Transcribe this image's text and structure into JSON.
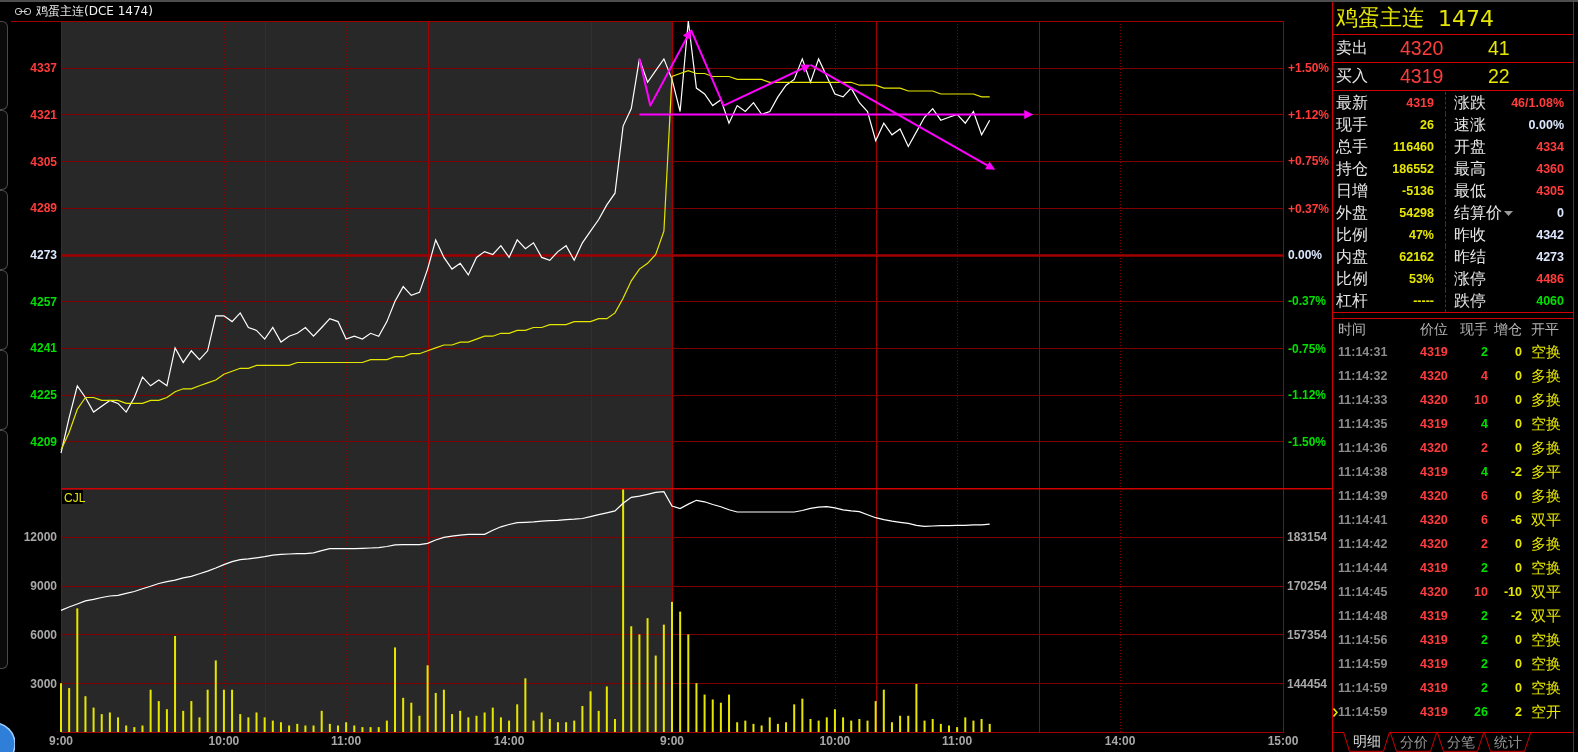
{
  "window": {
    "title": "鸡蛋主连(DCE 1474)"
  },
  "price_chart": {
    "chart_data": {
      "type": "line",
      "grid": true,
      "categories": [
        null,
        null,
        null,
        null,
        null,
        null,
        null,
        null,
        null,
        null,
        null,
        null,
        null,
        null,
        null,
        null,
        null,
        null,
        null,
        null,
        null,
        null,
        null,
        null,
        null,
        null,
        null,
        null,
        null,
        null,
        null,
        null,
        null,
        null,
        null,
        null,
        null,
        null,
        null,
        null,
        null,
        null,
        null,
        null,
        null,
        null,
        null,
        null,
        null,
        null,
        null,
        null,
        null,
        null,
        null,
        null,
        null,
        null,
        null,
        null,
        null,
        null,
        null,
        null,
        null,
        null,
        null,
        null,
        null,
        null,
        null,
        null,
        null,
        null,
        null,
        null,
        null,
        null,
        null,
        null,
        null,
        null,
        null,
        null,
        null,
        null,
        null,
        null,
        null,
        null,
        null,
        null,
        null,
        null,
        null,
        null,
        null,
        null,
        null,
        null,
        null,
        null,
        null,
        null,
        null,
        null,
        null,
        null,
        null,
        null,
        null,
        null,
        null,
        null,
        null,
        null,
        null,
        null,
        null,
        null,
        null,
        null,
        null,
        null,
        null,
        null,
        null,
        null,
        null,
        null,
        null,
        null,
        null,
        null,
        null,
        null,
        null,
        null,
        null,
        null,
        null,
        null,
        null,
        null,
        null,
        null,
        null,
        null,
        null,
        null,
        null
      ],
      "series": [
        {
          "color": "#ffffff",
          "values": [
            4205,
            4217,
            4228,
            4224,
            4219,
            4221,
            4223,
            4222,
            4219,
            4224,
            4231,
            4228,
            4230,
            4228,
            4241,
            4236,
            4240,
            4237,
            4240,
            4252,
            4252,
            4250,
            4253,
            4248,
            4247,
            4244,
            4248,
            4243,
            4245,
            4246,
            4248,
            4245,
            4248,
            4251,
            4250,
            4244,
            4245,
            4244,
            4246,
            4245,
            4250,
            4257,
            4262,
            4259,
            4260,
            4268,
            4278,
            4272,
            4268,
            4270,
            4266,
            4272,
            4274,
            4273,
            4276,
            4272,
            4278,
            4275,
            4277,
            4272,
            4271,
            4274,
            4276,
            4271,
            4277,
            4281,
            4285,
            4290,
            4294,
            4317,
            4323,
            4340,
            4332,
            4336,
            4340,
            4333,
            4322,
            4353,
            4330,
            4328,
            4324,
            4326,
            4318,
            4324,
            4322,
            4325,
            4321,
            4322,
            4327,
            4331,
            4333,
            4340,
            4332,
            4340,
            4334,
            4328,
            4327,
            4330,
            4325,
            4322,
            4312,
            4318,
            4314,
            4316,
            4310,
            4315,
            4320,
            4323,
            4319,
            4320,
            4321,
            4318,
            4322,
            4314,
            4319,
            null,
            null,
            null,
            null,
            null,
            null,
            null,
            null,
            null,
            null,
            null,
            null,
            null,
            null,
            null,
            null,
            null,
            null,
            null,
            null,
            null,
            null,
            null,
            null,
            null,
            null,
            null,
            null,
            null,
            null,
            null,
            null,
            null,
            null,
            null,
            null
          ]
        },
        {
          "color": "#e6e600",
          "values": [
            4206,
            4212,
            4220,
            4224,
            4224,
            4223,
            4223,
            4223,
            4222,
            4222,
            4222,
            4223,
            4223,
            4224,
            4226,
            4227,
            4227,
            4228,
            4229,
            4230,
            4232,
            4233,
            4234,
            4234,
            4235,
            4235,
            4235,
            4235,
            4235,
            4236,
            4236,
            4236,
            4236,
            4236,
            4236,
            4236,
            4236,
            4236,
            4237,
            4237,
            4237,
            4238,
            4238,
            4239,
            4239,
            4240,
            4241,
            4242,
            4242,
            4243,
            4243,
            4244,
            4245,
            4245,
            4246,
            4246,
            4247,
            4247,
            4248,
            4248,
            4249,
            4249,
            4249,
            4250,
            4250,
            4250,
            4251,
            4251,
            4253,
            4258,
            4264,
            4268,
            4270,
            4273,
            4281,
            4334,
            4335,
            4336,
            4335,
            4335,
            4334,
            4334,
            4334,
            4333,
            4333,
            4333,
            4333,
            4332,
            4332,
            4332,
            4332,
            4332,
            4332,
            4332,
            4332,
            4332,
            4332,
            4332,
            4331,
            4331,
            4331,
            4330,
            4330,
            4330,
            4329,
            4329,
            4329,
            4329,
            4328,
            4328,
            4328,
            4328,
            4328,
            4327,
            4327,
            null,
            null,
            null,
            null,
            null,
            null,
            null,
            null,
            null,
            null,
            null,
            null,
            null,
            null,
            null,
            null,
            null,
            null,
            null,
            null,
            null,
            null,
            null,
            null,
            null,
            null,
            null,
            null,
            null,
            null,
            null,
            null,
            null,
            null,
            null,
            null
          ]
        }
      ],
      "ylim": [
        4193,
        4353
      ],
      "yticks": [
        4209,
        4225,
        4241,
        4257,
        4273,
        4289,
        4305,
        4321,
        4337
      ],
      "y2lim": [
        -1.872,
        1.872
      ],
      "y2ticks": [
        {
          "value": -1.5,
          "label": "-1.50%"
        },
        {
          "value": -1.12,
          "label": "-1.12%"
        },
        {
          "value": -0.75,
          "label": "-0.75%"
        },
        {
          "value": -0.37,
          "label": "-0.37%"
        },
        {
          "value": 0,
          "label": "0.00%"
        },
        {
          "value": 0.37,
          "label": "+0.37%"
        },
        {
          "value": 0.75,
          "label": "+0.75%"
        },
        {
          "value": 1.12,
          "label": "+1.12%"
        },
        {
          "value": 1.5,
          "label": "+1.50%"
        }
      ],
      "ref_lines": [
        {
          "axis": "y",
          "value": 4273
        }
      ]
    }
  },
  "volume_chart": {
    "label": "CJL",
    "chart_data": {
      "type": "bar",
      "grid": true,
      "categories": [
        "9:00",
        null,
        null,
        null,
        null,
        null,
        null,
        null,
        null,
        null,
        null,
        null,
        null,
        null,
        null,
        null,
        null,
        null,
        null,
        null,
        "10:00",
        null,
        null,
        null,
        null,
        null,
        null,
        null,
        null,
        null,
        null,
        null,
        null,
        null,
        null,
        "11:00",
        null,
        null,
        null,
        null,
        null,
        null,
        null,
        null,
        null,
        null,
        null,
        null,
        null,
        null,
        null,
        null,
        null,
        null,
        null,
        "14:00",
        null,
        null,
        null,
        null,
        null,
        null,
        null,
        null,
        null,
        null,
        null,
        null,
        null,
        null,
        null,
        null,
        null,
        null,
        null,
        "9:00",
        null,
        null,
        null,
        null,
        null,
        null,
        null,
        null,
        null,
        null,
        null,
        null,
        null,
        null,
        null,
        null,
        null,
        null,
        null,
        "10:00",
        null,
        null,
        null,
        null,
        null,
        null,
        null,
        null,
        null,
        null,
        null,
        null,
        null,
        null,
        "11:00",
        null,
        null,
        null,
        null,
        null,
        null,
        null,
        null,
        null,
        null,
        null,
        null,
        null,
        null,
        null,
        null,
        null,
        null,
        null,
        "14:00",
        null,
        null,
        null,
        null,
        null,
        null,
        null,
        null,
        null,
        null,
        null,
        null,
        null,
        null,
        null,
        null,
        null,
        null,
        null,
        "15:00"
      ],
      "series": [
        {
          "type": "bar",
          "color": "#e6e600",
          "values": [
            3000,
            2700,
            7600,
            2200,
            1500,
            1100,
            1200,
            900,
            400,
            300,
            400,
            2600,
            1900,
            1400,
            5900,
            1300,
            1900,
            900,
            2600,
            4400,
            2600,
            2600,
            1100,
            900,
            1200,
            900,
            700,
            600,
            400,
            500,
            400,
            400,
            1300,
            500,
            400,
            600,
            400,
            300,
            300,
            300,
            700,
            5200,
            2100,
            1800,
            1000,
            4100,
            2400,
            2600,
            1100,
            1300,
            900,
            1000,
            1200,
            1500,
            900,
            700,
            1700,
            3300,
            700,
            1200,
            800,
            600,
            600,
            700,
            1600,
            2500,
            1300,
            2800,
            800,
            15000,
            6500,
            6000,
            7000,
            4700,
            6600,
            8000,
            7400,
            6000,
            3000,
            2300,
            2000,
            1800,
            2300,
            600,
            700,
            500,
            400,
            900,
            500,
            600,
            1700,
            2050,
            800,
            700,
            900,
            1400,
            900,
            700,
            800,
            700,
            1900,
            2600,
            600,
            1000,
            1000,
            2950,
            700,
            800,
            500,
            400,
            300,
            900,
            700,
            800,
            500,
            null,
            null,
            null,
            null,
            null,
            null,
            null,
            null,
            null,
            null,
            null,
            null,
            null,
            null,
            null,
            null,
            null,
            null,
            null,
            null,
            null,
            null,
            null,
            null,
            null,
            null,
            null,
            null,
            null,
            null,
            null,
            null,
            null,
            null,
            null,
            null
          ]
        },
        {
          "type": "line",
          "axis": "y2",
          "color": "#ffffff",
          "values": [
            163700,
            164600,
            165400,
            166200,
            166600,
            167100,
            167500,
            167700,
            168200,
            168700,
            169400,
            170100,
            170800,
            171300,
            171700,
            172300,
            172700,
            173400,
            174100,
            174900,
            175800,
            176600,
            177100,
            177300,
            177600,
            177900,
            178300,
            178500,
            178600,
            178700,
            178700,
            178900,
            179500,
            180000,
            180000,
            180000,
            180000,
            180100,
            180200,
            180300,
            180600,
            181000,
            181100,
            181100,
            181100,
            181400,
            182300,
            183000,
            183300,
            183600,
            183800,
            183800,
            183800,
            184900,
            185800,
            186400,
            186900,
            187000,
            187100,
            187300,
            187400,
            187500,
            187700,
            187800,
            188000,
            188500,
            189000,
            189500,
            190000,
            192000,
            193600,
            193900,
            194400,
            194900,
            195100,
            191300,
            190600,
            191800,
            192800,
            192400,
            191700,
            191100,
            190300,
            189700,
            189700,
            189700,
            189700,
            189700,
            189700,
            189700,
            189700,
            190100,
            190700,
            191000,
            191100,
            190800,
            190300,
            190000,
            189800,
            189000,
            188200,
            187700,
            187300,
            187000,
            186700,
            186200,
            185900,
            186000,
            186100,
            186100,
            186200,
            186200,
            186300,
            186300,
            186500,
            null,
            null,
            null,
            null,
            null,
            null,
            null,
            null,
            null,
            null,
            null,
            null,
            null,
            null,
            null,
            null,
            null,
            null,
            null,
            null,
            null,
            null,
            null,
            null,
            null,
            null,
            null,
            null,
            null,
            null,
            null,
            null,
            null,
            null,
            null,
            null
          ]
        }
      ],
      "ylim": [
        0,
        15000
      ],
      "y2lim": [
        131554,
        196054
      ],
      "yticks": [
        3000,
        6000,
        9000,
        12000
      ],
      "y2ticks": [
        144454,
        157354,
        170254,
        183154
      ]
    }
  },
  "quote": {
    "name": "鸡蛋主连",
    "code": "1474",
    "book": [
      {
        "label": "卖出",
        "price": "4320",
        "volume": "41"
      },
      {
        "label": "买入",
        "price": "4319",
        "volume": "22"
      }
    ],
    "stats": [
      {
        "kind": "plain",
        "label": "最新",
        "value": "4319",
        "color": "#ff3c3c"
      },
      {
        "kind": "plain",
        "label": "涨跌",
        "value": "46/1.08%",
        "color": "#ff3c3c"
      },
      {
        "kind": "plain",
        "label": "现手",
        "value": "26",
        "color": "#e6e600"
      },
      {
        "kind": "plain",
        "label": "速涨",
        "value": "0.00%",
        "color": "#dde8ff"
      },
      {
        "kind": "plain",
        "label": "总手",
        "value": "116460",
        "color": "#e6e600"
      },
      {
        "kind": "plain",
        "label": "开盘",
        "value": "4334",
        "color": "#ff3c3c"
      },
      {
        "kind": "plain",
        "label": "持仓",
        "value": "186552",
        "color": "#e6e600"
      },
      {
        "kind": "plain",
        "label": "最高",
        "value": "4360",
        "color": "#ff3c3c"
      },
      {
        "kind": "plain",
        "label": "日增",
        "value": "-5136",
        "color": "#e6e600"
      },
      {
        "kind": "plain",
        "label": "最低",
        "value": "4305",
        "color": "#ff3c3c"
      },
      {
        "kind": "plain",
        "label": "外盘",
        "value": "54298",
        "color": "#e6e600"
      },
      {
        "kind": "dropdown",
        "label": "结算价",
        "value": "0",
        "color": "#dde8ff"
      },
      {
        "kind": "plain",
        "label": "比例",
        "value": "47%",
        "color": "#e6e600"
      },
      {
        "kind": "plain",
        "label": "昨收",
        "value": "4342",
        "color": "#dde8ff"
      },
      {
        "kind": "plain",
        "label": "内盘",
        "value": "62162",
        "color": "#e6e600"
      },
      {
        "kind": "plain",
        "label": "昨结",
        "value": "4273",
        "color": "#dde8ff"
      },
      {
        "kind": "plain",
        "label": "比例",
        "value": "53%",
        "color": "#e6e600"
      },
      {
        "kind": "plain",
        "label": "涨停",
        "value": "4486",
        "color": "#ff3c3c"
      },
      {
        "kind": "plain",
        "label": "杠杆",
        "value": "-----",
        "color": "#e6e600"
      },
      {
        "kind": "plain",
        "label": "跌停",
        "value": "4060",
        "color": "#00e000"
      }
    ]
  },
  "trades": {
    "columns": [
      "时间",
      "价位",
      "现手",
      "增仓",
      "开平"
    ],
    "rows": [
      {
        "time": "11:14:31",
        "price": "4319",
        "volume": "2",
        "color": "#00e000",
        "change": "0",
        "action": "空换",
        "selected": false
      },
      {
        "time": "11:14:32",
        "price": "4320",
        "volume": "4",
        "color": "#ff3c3c",
        "change": "0",
        "action": "多换",
        "selected": false
      },
      {
        "time": "11:14:33",
        "price": "4320",
        "volume": "10",
        "color": "#ff3c3c",
        "change": "0",
        "action": "多换",
        "selected": false
      },
      {
        "time": "11:14:35",
        "price": "4319",
        "volume": "4",
        "color": "#00e000",
        "change": "0",
        "action": "空换",
        "selected": false
      },
      {
        "time": "11:14:36",
        "price": "4320",
        "volume": "2",
        "color": "#ff3c3c",
        "change": "0",
        "action": "多换",
        "selected": false
      },
      {
        "time": "11:14:38",
        "price": "4319",
        "volume": "4",
        "color": "#00e000",
        "change": "-2",
        "action": "多平",
        "selected": false
      },
      {
        "time": "11:14:39",
        "price": "4320",
        "volume": "6",
        "color": "#ff3c3c",
        "change": "0",
        "action": "多换",
        "selected": false
      },
      {
        "time": "11:14:41",
        "price": "4320",
        "volume": "6",
        "color": "#ff3c3c",
        "change": "-6",
        "action": "双平",
        "selected": false
      },
      {
        "time": "11:14:42",
        "price": "4320",
        "volume": "2",
        "color": "#ff3c3c",
        "change": "0",
        "action": "多换",
        "selected": false
      },
      {
        "time": "11:14:44",
        "price": "4319",
        "volume": "2",
        "color": "#00e000",
        "change": "0",
        "action": "空换",
        "selected": false
      },
      {
        "time": "11:14:45",
        "price": "4320",
        "volume": "10",
        "color": "#ff3c3c",
        "change": "-10",
        "action": "双平",
        "selected": false
      },
      {
        "time": "11:14:48",
        "price": "4319",
        "volume": "2",
        "color": "#00e000",
        "change": "-2",
        "action": "双平",
        "selected": false
      },
      {
        "time": "11:14:56",
        "price": "4319",
        "volume": "2",
        "color": "#00e000",
        "change": "0",
        "action": "空换",
        "selected": false
      },
      {
        "time": "11:14:59",
        "price": "4319",
        "volume": "2",
        "color": "#00e000",
        "change": "0",
        "action": "空换",
        "selected": false
      },
      {
        "time": "11:14:59",
        "price": "4319",
        "volume": "2",
        "color": "#00e000",
        "change": "0",
        "action": "空换",
        "selected": false
      },
      {
        "time": "11:14:59",
        "price": "4319",
        "volume": "26",
        "color": "#00e000",
        "change": "2",
        "action": "空开",
        "selected": true
      }
    ]
  },
  "panel_tabs": [
    {
      "label": "明细",
      "selected": true
    },
    {
      "label": "分价",
      "selected": false
    },
    {
      "label": "分笔",
      "selected": false
    },
    {
      "label": "统计",
      "selected": false
    }
  ]
}
